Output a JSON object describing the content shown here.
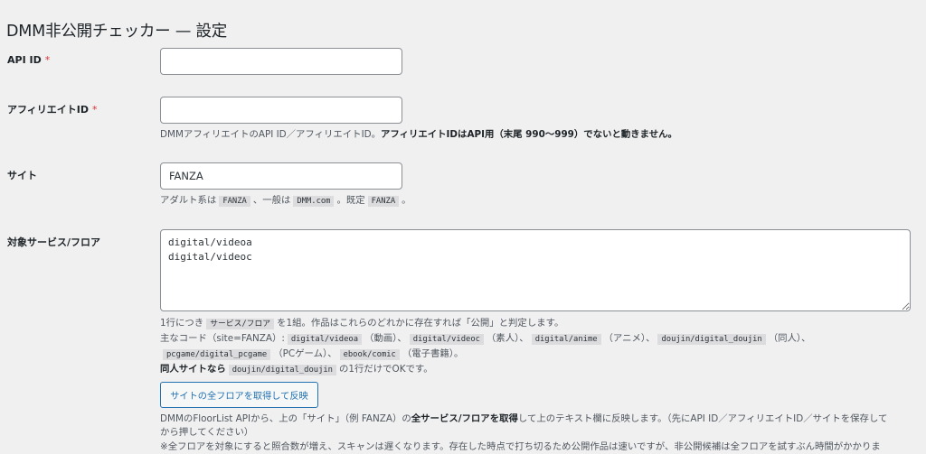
{
  "page": {
    "title": "DMM非公開チェッカー — 設定"
  },
  "required_mark": "*",
  "fields": {
    "api_id": {
      "label": "API ID",
      "value": ""
    },
    "affiliate_id": {
      "label": "アフィリエイトID",
      "value": "",
      "desc_plain": "DMMアフィリエイトのAPI ID／アフィリエイトID。",
      "desc_bold": "アフィリエイトIDはAPI用（末尾 990〜999）でないと動きません。"
    },
    "site": {
      "label": "サイト",
      "value": "FANZA",
      "desc": {
        "t1": "アダルト系は",
        "c1": "FANZA",
        "t2": "、一般は",
        "c2": "DMM.com",
        "t3": "。既定",
        "c3": "FANZA",
        "t4": "。"
      }
    },
    "floors": {
      "label": "対象サービス/フロア",
      "value": "digital/videoa\ndigital/videoc",
      "line1": {
        "t1": "1行につき",
        "c1": "サービス/フロア",
        "t2": "を1組。作品はこれらのどれかに存在すれば「公開」と判定します。"
      },
      "line2": {
        "t1": "主なコード（site=FANZA）:",
        "c1": "digital/videoa",
        "t2": "（動画）、",
        "c2": "digital/videoc",
        "t3": "（素人）、",
        "c3": "digital/anime",
        "t4": "（アニメ）、",
        "c4": "doujin/digital_doujin",
        "t5": "（同人）、"
      },
      "line3": {
        "c1": "pcgame/digital_pcgame",
        "t1": "（PCゲーム）、",
        "c2": "ebook/comic",
        "t2": "（電子書籍）。"
      },
      "line4": {
        "b1": "同人サイトなら",
        "c1": "doujin/digital_doujin",
        "t1": "の1行だけでOKです。"
      }
    }
  },
  "fetch_button": {
    "label": "サイトの全フロアを取得して反映"
  },
  "fetch_desc": {
    "line1_t1": "DMMのFloorList APIから、上の「サイト」（例 FANZA）の",
    "line1_b1": "全サービス/フロアを取得",
    "line1_t2": "して上のテキスト欄に反映します。（先にAPI ID／アフィリエイトID／サイトを保存して",
    "line2": "から押してください）",
    "line3": "※全フロアを対象にすると照合数が増え、スキャンは遅くなります。存在した時点で打ち切るため公開作品は速いですが、非公開候補は全フロアを試すぶん時間がかかりま"
  }
}
